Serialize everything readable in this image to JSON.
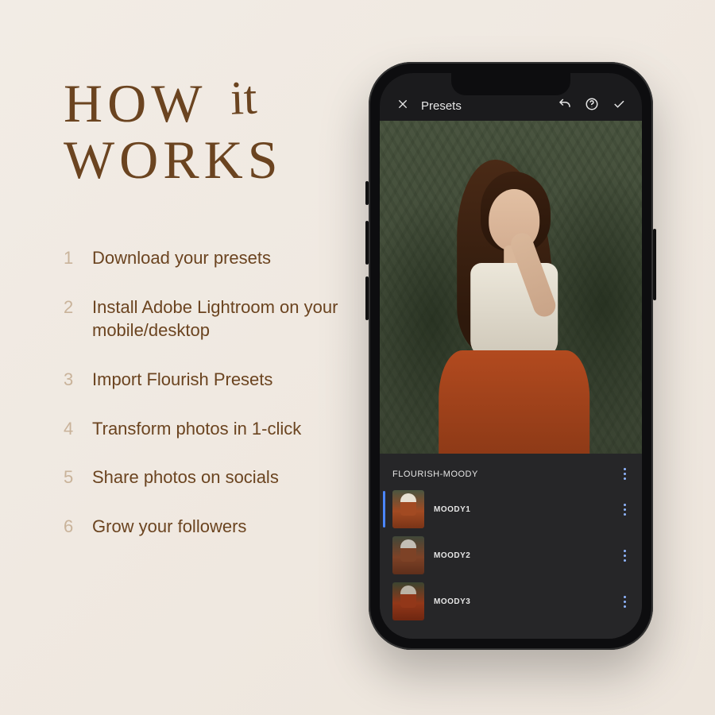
{
  "heading": {
    "word1": "HOW",
    "word_script": "it",
    "word2": "WORKS"
  },
  "steps": [
    {
      "n": "1",
      "text": "Download your presets"
    },
    {
      "n": "2",
      "text": "Install Adobe Lightroom on your mobile/desktop"
    },
    {
      "n": "3",
      "text": "Import Flourish Presets"
    },
    {
      "n": "4",
      "text": "Transform photos in 1-click"
    },
    {
      "n": "5",
      "text": "Share photos on socials"
    },
    {
      "n": "6",
      "text": "Grow your followers"
    }
  ],
  "app": {
    "header_title": "Presets",
    "preset_group": "FLOURISH-MOODY",
    "presets": [
      {
        "label": "MOODY1"
      },
      {
        "label": "MOODY2"
      },
      {
        "label": "MOODY3"
      }
    ]
  }
}
